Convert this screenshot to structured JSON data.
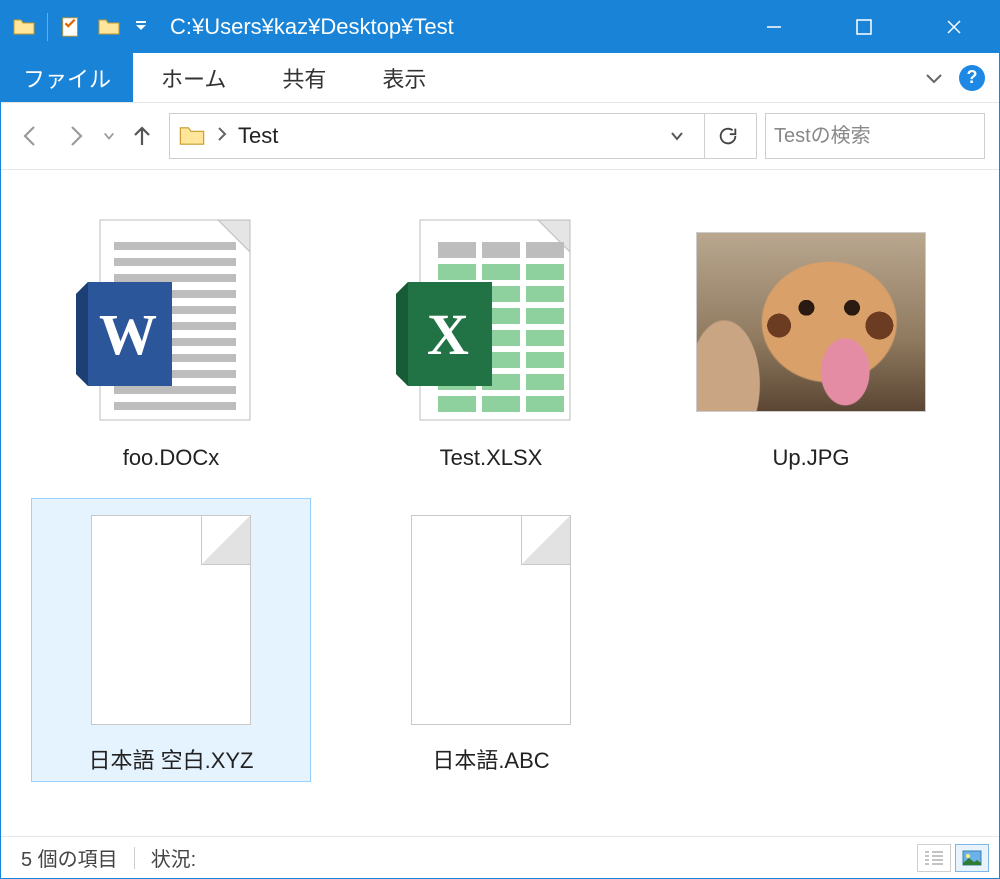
{
  "titlebar": {
    "title": "C:¥Users¥kaz¥Desktop¥Test"
  },
  "ribbon": {
    "file": "ファイル",
    "tabs": [
      "ホーム",
      "共有",
      "表示"
    ]
  },
  "addressbar": {
    "crumb": "Test"
  },
  "search": {
    "placeholder": "Testの検索"
  },
  "files": [
    {
      "name": "foo.DOCx",
      "type": "docx",
      "selected": false
    },
    {
      "name": "Test.XLSX",
      "type": "xlsx",
      "selected": false
    },
    {
      "name": "Up.JPG",
      "type": "jpg",
      "selected": false
    },
    {
      "name": "日本語 空白.XYZ",
      "type": "blank",
      "selected": true
    },
    {
      "name": "日本語.ABC",
      "type": "blank",
      "selected": false
    }
  ],
  "statusbar": {
    "count_text": "5 個の項目",
    "status_label": "状況:"
  }
}
